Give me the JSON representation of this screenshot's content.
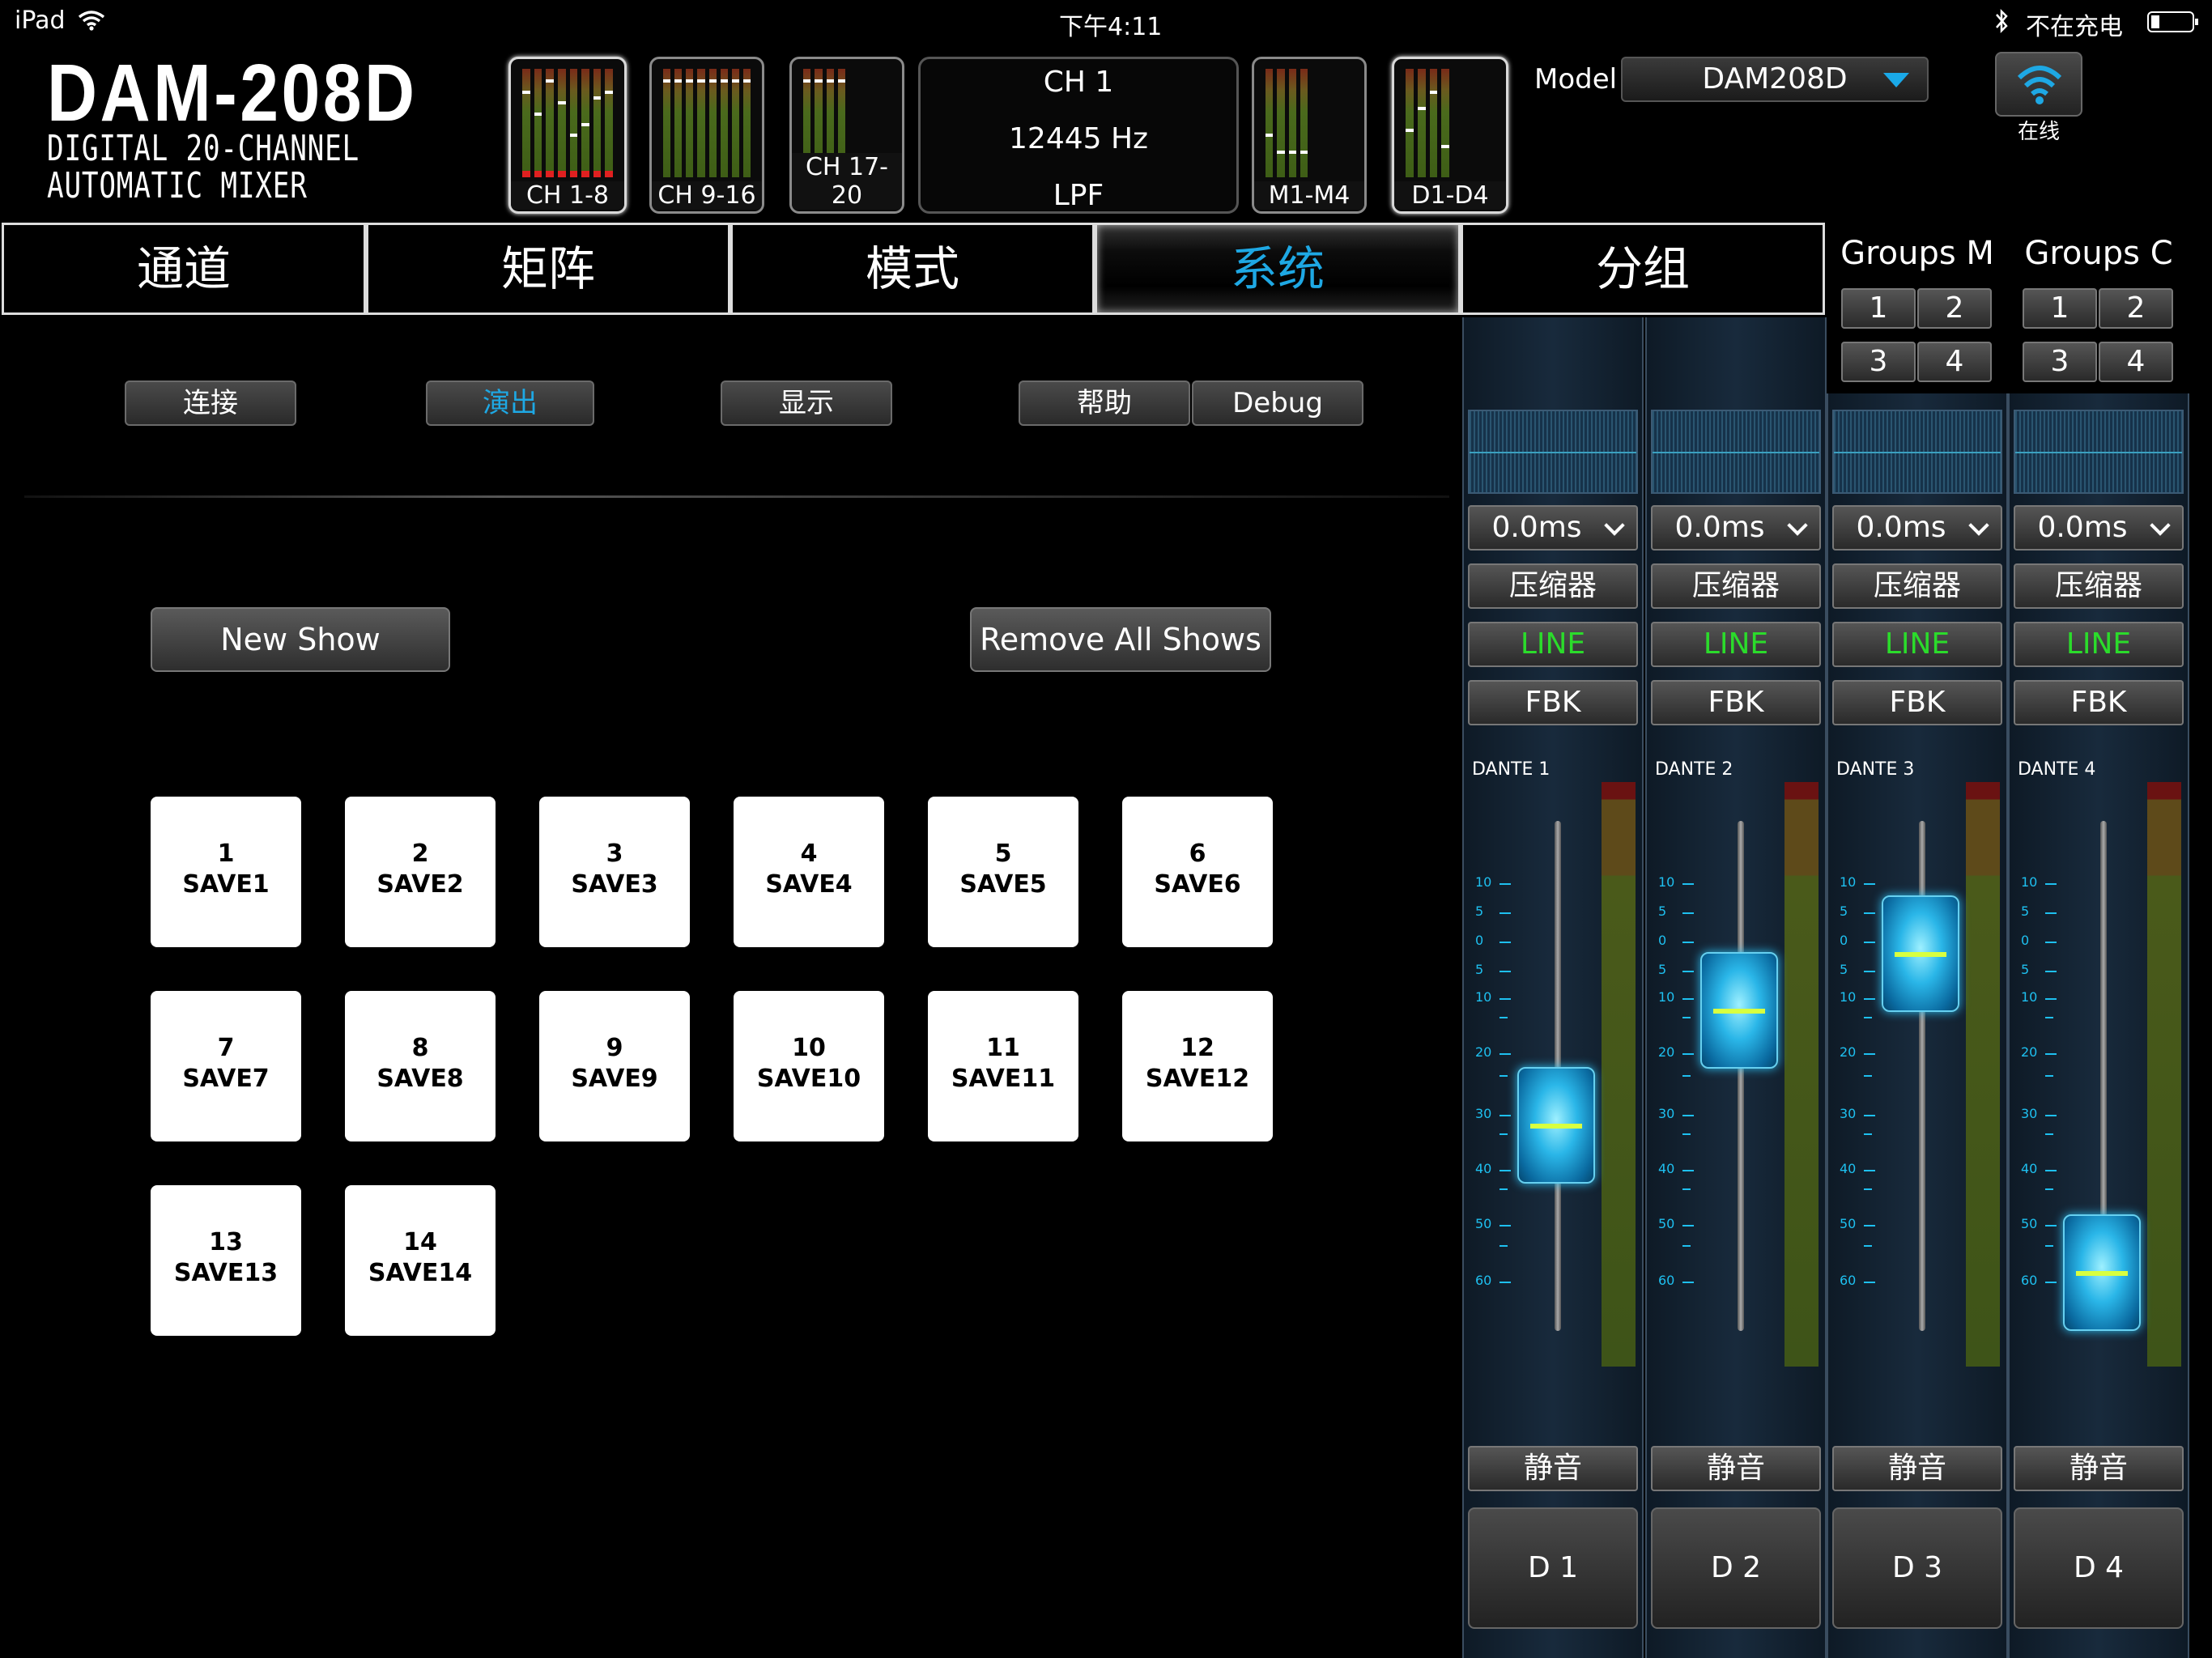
{
  "status": {
    "device": "iPad",
    "time": "下午4:11",
    "charge": "不在充电"
  },
  "logo": {
    "title": "DAM-208D",
    "line1": "DIGITAL 20-CHANNEL",
    "line2": "AUTOMATIC MIXER"
  },
  "thumbs": [
    "CH 1-8",
    "CH 9-16",
    "CH 17-20",
    "M1-M4",
    "D1-D4"
  ],
  "freq": {
    "channel": "CH 1",
    "value": "12445 Hz",
    "filter": "LPF"
  },
  "model": {
    "label": "Model",
    "value": "DAM208D"
  },
  "wifi": {
    "status": "在线"
  },
  "tabs": [
    "通道",
    "矩阵",
    "模式",
    "系统",
    "分组"
  ],
  "subtabs": {
    "connect": "连接",
    "show": "演出",
    "display": "显示",
    "help": "帮助",
    "debug": "Debug"
  },
  "actions": {
    "new_show": "New Show",
    "remove_all": "Remove All Shows"
  },
  "saves": [
    {
      "num": "1",
      "name": "SAVE1"
    },
    {
      "num": "2",
      "name": "SAVE2"
    },
    {
      "num": "3",
      "name": "SAVE3"
    },
    {
      "num": "4",
      "name": "SAVE4"
    },
    {
      "num": "5",
      "name": "SAVE5"
    },
    {
      "num": "6",
      "name": "SAVE6"
    },
    {
      "num": "7",
      "name": "SAVE7"
    },
    {
      "num": "8",
      "name": "SAVE8"
    },
    {
      "num": "9",
      "name": "SAVE9"
    },
    {
      "num": "10",
      "name": "SAVE10"
    },
    {
      "num": "11",
      "name": "SAVE11"
    },
    {
      "num": "12",
      "name": "SAVE12"
    },
    {
      "num": "13",
      "name": "SAVE13"
    },
    {
      "num": "14",
      "name": "SAVE14"
    }
  ],
  "groups": {
    "m": {
      "title": "Groups M",
      "buttons": [
        "1",
        "2",
        "3",
        "4"
      ]
    },
    "c": {
      "title": "Groups C",
      "buttons": [
        "1",
        "2",
        "3",
        "4"
      ]
    }
  },
  "scale": [
    "10",
    "5",
    "0",
    "5",
    "10",
    "20",
    "30",
    "40",
    "50",
    "60"
  ],
  "strips": [
    {
      "dante": "DANTE 1",
      "delay": "0.0ms",
      "comp": "压缩器",
      "line": "LINE",
      "fbk": "FBK",
      "mute": "静音",
      "label": "D 1"
    },
    {
      "dante": "DANTE 2",
      "delay": "0.0ms",
      "comp": "压缩器",
      "line": "LINE",
      "fbk": "FBK",
      "mute": "静音",
      "label": "D 2"
    },
    {
      "dante": "DANTE 3",
      "delay": "0.0ms",
      "comp": "压缩器",
      "line": "LINE",
      "fbk": "FBK",
      "mute": "静音",
      "label": "D 3"
    },
    {
      "dante": "DANTE 4",
      "delay": "0.0ms",
      "comp": "压缩器",
      "line": "LINE",
      "fbk": "FBK",
      "mute": "静音",
      "label": "D 4"
    }
  ],
  "colors": {
    "accent": "#1ea8e4",
    "line_green": "#2bdc2b",
    "strip_bg": "#182a3c"
  }
}
